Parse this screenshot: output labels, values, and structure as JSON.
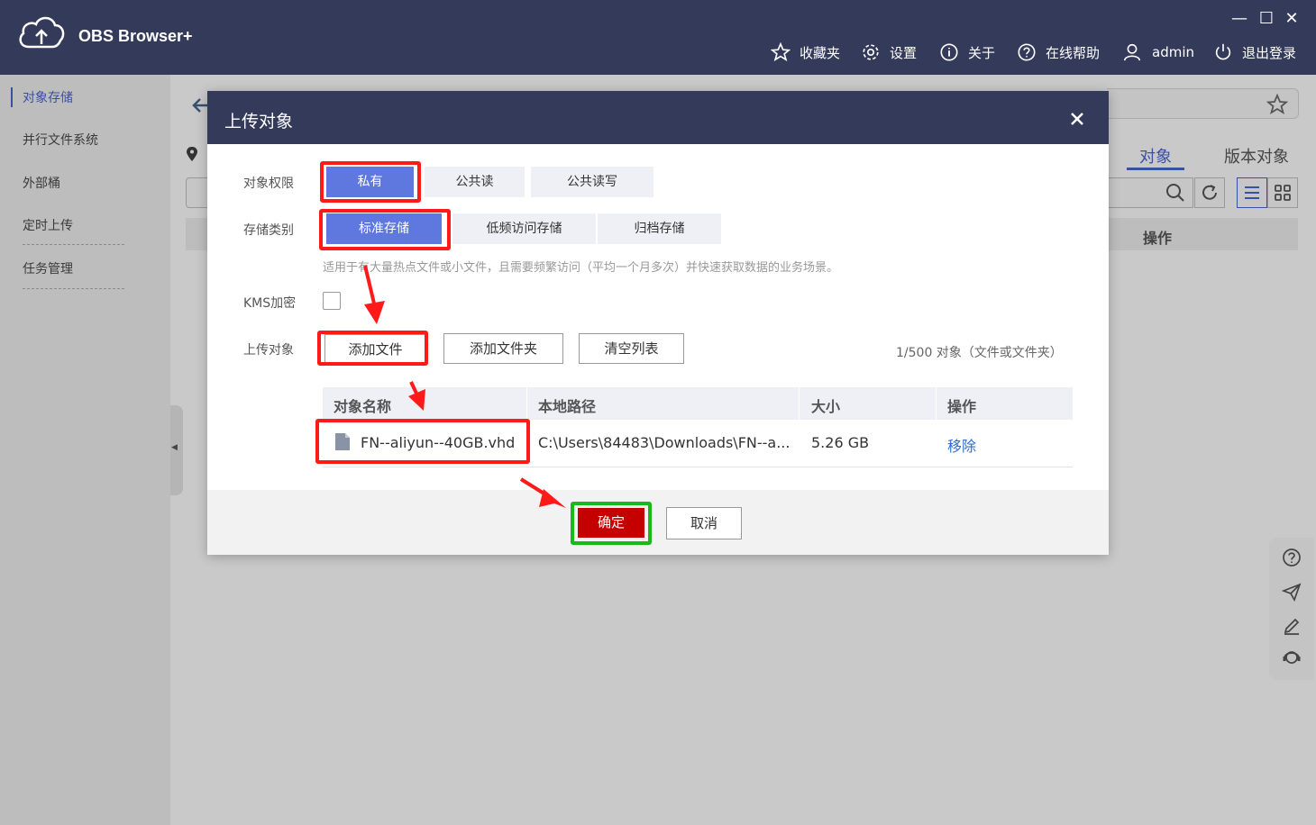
{
  "app": {
    "name": "OBS Browser+",
    "nav": {
      "favorites": "收藏夹",
      "settings": "设置",
      "about": "关于",
      "help": "在线帮助",
      "user": "admin",
      "logout": "退出登录"
    }
  },
  "sidebar": {
    "items": [
      {
        "label": "对象存储"
      },
      {
        "label": "并行文件系统"
      },
      {
        "label": "外部桶"
      },
      {
        "label": "定时上传"
      },
      {
        "label": "任务管理"
      }
    ]
  },
  "background": {
    "tabs": [
      "对象",
      "版本对象"
    ],
    "table_operation_header": "操作"
  },
  "dialog": {
    "title": "上传对象",
    "permission": {
      "label": "对象权限",
      "options": [
        "私有",
        "公共读",
        "公共读写"
      ],
      "selected": "私有"
    },
    "storage_class": {
      "label": "存储类别",
      "options": [
        "标准存储",
        "低频访问存储",
        "归档存储"
      ],
      "selected": "标准存储",
      "hint": "适用于有大量热点文件或小文件，且需要频繁访问（平均一个月多次）并快速获取数据的业务场景。"
    },
    "kms": {
      "label": "KMS加密",
      "checked": false
    },
    "upload": {
      "label": "上传对象",
      "add_file": "添加文件",
      "add_folder": "添加文件夹",
      "clear_list": "清空列表",
      "count": "1/500 对象（文件或文件夹）"
    },
    "table": {
      "columns": [
        "对象名称",
        "本地路径",
        "大小",
        "操作"
      ],
      "rows": [
        {
          "name": "FN--aliyun--40GB.vhd",
          "path": "C:\\Users\\84483\\Downloads\\FN--a...",
          "size": "5.26 GB",
          "action": "移除"
        }
      ]
    },
    "confirm": "确定",
    "cancel": "取消"
  },
  "colors": {
    "header_bg": "#343a5a",
    "selected_option": "#5f78e0",
    "confirm_button": "#c40000",
    "highlight_red": "#ff1a1a",
    "highlight_green": "#18b918",
    "link": "#2f6dd0"
  }
}
